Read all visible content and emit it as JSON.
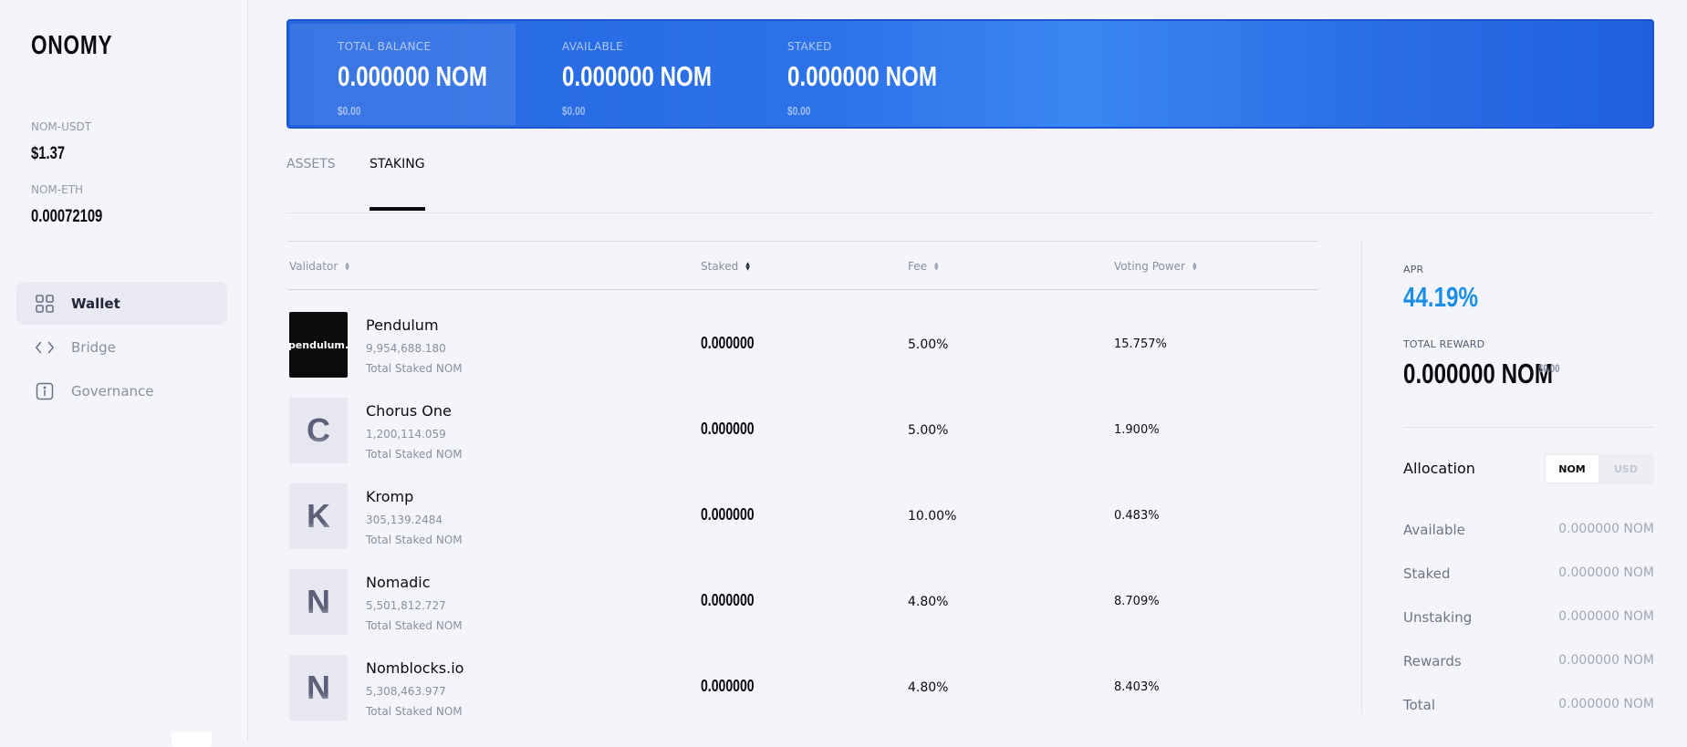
{
  "sidebar": {
    "logo": "ONOMY",
    "prices": [
      {
        "label": "NOM-USDT",
        "value": "$1.37"
      },
      {
        "label": "NOM-ETH",
        "value": "0.00072109"
      }
    ],
    "nav": [
      {
        "label": "Wallet",
        "icon": "grid-icon",
        "active": true
      },
      {
        "label": "Bridge",
        "icon": "code-brackets-icon",
        "active": false
      },
      {
        "label": "Governance",
        "icon": "info-icon",
        "active": false
      }
    ]
  },
  "balances": [
    {
      "label": "TOTAL BALANCE",
      "value": "0.000000 NOM",
      "usd": "$0.00"
    },
    {
      "label": "AVAILABLE",
      "value": "0.000000 NOM",
      "usd": "$0.00"
    },
    {
      "label": "STAKED",
      "value": "0.000000 NOM",
      "usd": "$0.00"
    }
  ],
  "tabs": [
    {
      "label": "ASSETS",
      "active": false
    },
    {
      "label": "STAKING",
      "active": true
    }
  ],
  "table": {
    "columns": [
      "Validator",
      "Staked",
      "Fee",
      "Voting Power"
    ],
    "rows": [
      {
        "avatar": "pendulum.",
        "name": "Pendulum",
        "total": "9,954,688.180",
        "sub": "Total Staked NOM",
        "staked": "0.000000",
        "fee": "5.00%",
        "voting_power": "15.757%"
      },
      {
        "avatar": "C",
        "name": "Chorus One",
        "total": "1,200,114.059",
        "sub": "Total Staked NOM",
        "staked": "0.000000",
        "fee": "5.00%",
        "voting_power": "1.900%"
      },
      {
        "avatar": "K",
        "name": "Kromp",
        "total": "305,139.2484",
        "sub": "Total Staked NOM",
        "staked": "0.000000",
        "fee": "10.00%",
        "voting_power": "0.483%"
      },
      {
        "avatar": "N",
        "name": "Nomadic",
        "total": "5,501,812.727",
        "sub": "Total Staked NOM",
        "staked": "0.000000",
        "fee": "4.80%",
        "voting_power": "8.709%"
      },
      {
        "avatar": "N",
        "name": "Nomblocks.io",
        "total": "5,308,463.977",
        "sub": "Total Staked NOM",
        "staked": "0.000000",
        "fee": "4.80%",
        "voting_power": "8.403%"
      }
    ]
  },
  "summary": {
    "apr_label": "APR",
    "apr_value": "44.19%",
    "reward_label": "TOTAL REWARD",
    "reward_value": "0.000000 NOM",
    "reward_usd": "$0.00",
    "allocation_title": "Allocation",
    "toggle": [
      "NOM",
      "USD"
    ],
    "allocation": [
      {
        "label": "Available",
        "value": "0.000000 NOM"
      },
      {
        "label": "Staked",
        "value": "0.000000 NOM"
      },
      {
        "label": "Unstaking",
        "value": "0.000000 NOM"
      },
      {
        "label": "Rewards",
        "value": "0.000000 NOM"
      },
      {
        "label": "Total",
        "value": "0.000000 NOM"
      }
    ]
  },
  "colors": {
    "banner": "#2e72ea",
    "apr": "#1a8ee6",
    "background": "#f4f5fa"
  }
}
